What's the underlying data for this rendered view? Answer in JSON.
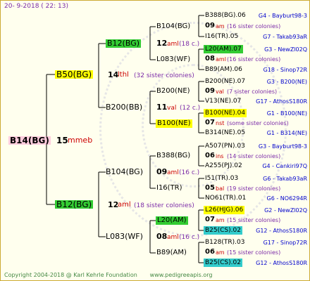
{
  "header": {
    "date": "20- 9-2018 ( 22: 13)"
  },
  "footer": {
    "copyright": "Copyright 2004-2018 @ Karl Kehrle Foundation",
    "url": "www.pedigreeapis.org"
  },
  "root": {
    "id": "B14(BG)",
    "num": "15",
    "code": "mmeb"
  },
  "gen1": [
    {
      "id": "B50(BG)",
      "num": "14",
      "code": "lthl",
      "sisters": "(32 sister colonies)"
    },
    {
      "id": "B12(BG)",
      "num": "12",
      "code": "aml",
      "sisters": "(18 sister colonies)"
    }
  ],
  "gen2": [
    {
      "id": "B12(BG)"
    },
    {
      "id": "B200(BB)",
      "num": "11",
      "code": "val",
      "sisters": "(12 c.)"
    },
    {
      "id": "B104(BG)"
    },
    {
      "id": "L083(WF)"
    }
  ],
  "gen3": [
    {
      "id": "B104(BG)"
    },
    {
      "num": "12",
      "code": "aml",
      "sisters": "(18 c.)"
    },
    {
      "id": "L083(WF)"
    },
    {
      "id": "B200(NE)"
    },
    {
      "id": "B100(NE)"
    },
    {
      "id": "B388(BG)"
    },
    {
      "num": "09",
      "code": "aml",
      "sisters": "(16 c.)"
    },
    {
      "id": "I16(TR)"
    },
    {
      "id": "L20(AM)"
    },
    {
      "num": "08",
      "code": "aml",
      "sisters": "(16 c.)"
    },
    {
      "id": "B89(AM)"
    }
  ],
  "gen4": [
    {
      "left": "B388(BG).06",
      "right": "G4 - Bayburt98-3"
    },
    {
      "left": "09",
      "mid": "am",
      "sisters": "(16 sister colonies)"
    },
    {
      "left": "I16(TR).05",
      "right": "G7 - Takab93aR"
    },
    {
      "left": "L20(AM).07",
      "right": "G3 - NewZl02Q"
    },
    {
      "left": "08",
      "mid": "aml",
      "sisters": "(16 sister colonies)"
    },
    {
      "left": "B89(AM).06",
      "right": "G18 - Sinop72R"
    },
    {
      "left": "B200(NE).07",
      "right": "G3 - B200(NE)"
    },
    {
      "left": "09",
      "mid": "val",
      "sisters": "(7 sister colonies)"
    },
    {
      "left": "V13(NE).07",
      "right": "G17 - AthosS180R"
    },
    {
      "left": "B100(NE).04",
      "right": "G1 - B100(NE)"
    },
    {
      "left": "07",
      "mid": "nst",
      "sisters": "(some sister colonies)"
    },
    {
      "left": "B314(NE).05",
      "right": "G1 - B314(NE)"
    },
    {
      "left": "A507(PN).03",
      "right": "G3 - Bayburt98-3"
    },
    {
      "left": "06",
      "mid": "ins",
      "sisters": "(14 sister colonies)"
    },
    {
      "left": "A255(PJ).02",
      "right": "G4 - Cankiri97Q"
    },
    {
      "left": "I51(TR).03",
      "right": "G6 - Takab93aR"
    },
    {
      "left": "05",
      "mid": "bal",
      "sisters": "(19 sister colonies)"
    },
    {
      "left": "NO61(TR).01",
      "right": "G6 - NO6294R"
    },
    {
      "left": "L26(HJG).06",
      "right": "G2 - NewZl02Q"
    },
    {
      "left": "07",
      "mid": "am",
      "sisters": "(15 sister colonies)"
    },
    {
      "left": "B25(CS).02",
      "right": "G12 - AthosS180R"
    },
    {
      "left": "B128(TR).03",
      "right": "G17 - Sinop72R"
    },
    {
      "left": "06",
      "mid": "am",
      "sisters": "(15 sister colonies)"
    },
    {
      "left": "B25(CS).02",
      "right": "G12 - AthosS180R"
    }
  ],
  "colors": {
    "background": "#ffffee",
    "green": "#33cc33",
    "yellow": "#ffff00",
    "cyan": "#33cccc",
    "pink": "#ffccdd",
    "blue": "#0000cc",
    "purple": "#7b2aa8"
  }
}
